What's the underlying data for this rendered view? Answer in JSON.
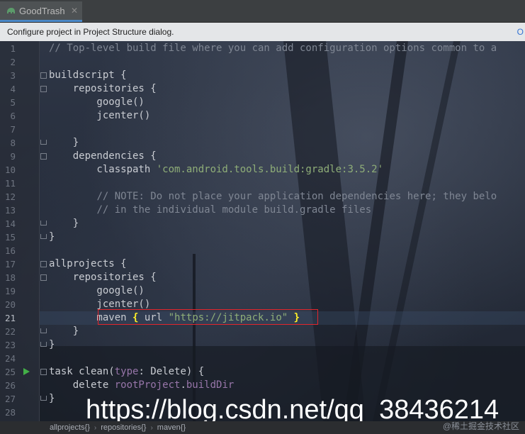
{
  "tab": {
    "label": "GoodTrash",
    "close": "✕"
  },
  "notice": {
    "text": "Configure project in Project Structure dialog.",
    "action": "O"
  },
  "editor": {
    "lines": [
      {
        "n": "1",
        "html": "<span class='c-comment'>// Top-level build file where you can add configuration options common to a</span>"
      },
      {
        "n": "2",
        "html": ""
      },
      {
        "n": "3",
        "html": "buildscript {"
      },
      {
        "n": "4",
        "html": "    repositories {"
      },
      {
        "n": "5",
        "html": "        google()"
      },
      {
        "n": "6",
        "html": "        jcenter()"
      },
      {
        "n": "7",
        "html": ""
      },
      {
        "n": "8",
        "html": "    }"
      },
      {
        "n": "9",
        "html": "    dependencies {"
      },
      {
        "n": "10",
        "html": "        classpath <span class='c-str'>'com.android.tools.build:gradle:3.5.2'</span>"
      },
      {
        "n": "11",
        "html": ""
      },
      {
        "n": "12",
        "html": "        <span class='c-comment'>// NOTE: Do not place your application dependencies here; they belo</span>"
      },
      {
        "n": "13",
        "html": "        <span class='c-comment'>// in the individual module build.gradle files</span>"
      },
      {
        "n": "14",
        "html": "    }"
      },
      {
        "n": "15",
        "html": "}"
      },
      {
        "n": "16",
        "html": ""
      },
      {
        "n": "17",
        "html": "allprojects {"
      },
      {
        "n": "18",
        "html": "    repositories {"
      },
      {
        "n": "19",
        "html": "        google()"
      },
      {
        "n": "20",
        "html": "        jcenter()"
      },
      {
        "n": "21",
        "html": "        maven <span class='c-brace'>{</span> url <span class='c-str'>\"https://jitpack.io\"</span> <span class='c-brace'>}</span>"
      },
      {
        "n": "22",
        "html": "    }"
      },
      {
        "n": "23",
        "html": "}"
      },
      {
        "n": "24",
        "html": ""
      },
      {
        "n": "25",
        "html": "task clean(<span class='c-purple'>type</span>: Delete) {"
      },
      {
        "n": "26",
        "html": "    delete <span class='c-purple'>rootProject</span>.<span class='c-purple'>buildDir</span>"
      },
      {
        "n": "27",
        "html": "}"
      },
      {
        "n": "28",
        "html": ""
      }
    ],
    "current_line": "21"
  },
  "watermark": {
    "url": "https://blog.csdn.net/qq_38436214",
    "site": "@稀土掘金技术社区"
  },
  "breadcrumbs": [
    "allprojects{}",
    "repositories{}",
    "maven{}"
  ]
}
